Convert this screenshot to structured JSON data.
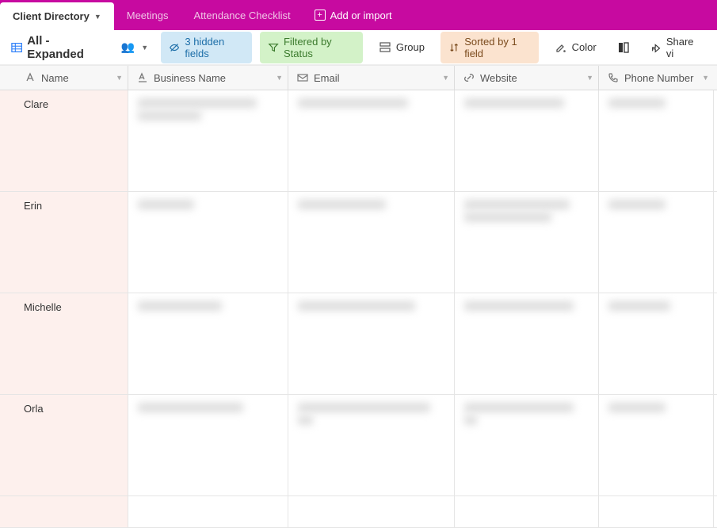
{
  "tabs": {
    "items": [
      {
        "label": "Client Directory",
        "active": true
      },
      {
        "label": "Meetings",
        "active": false
      },
      {
        "label": "Attendance Checklist",
        "active": false
      }
    ],
    "add_label": "Add or import"
  },
  "toolbar": {
    "view_name": "All - Expanded",
    "hidden_fields": "3 hidden fields",
    "filtered": "Filtered by Status",
    "group": "Group",
    "sorted": "Sorted by 1 field",
    "color": "Color",
    "share": "Share vi"
  },
  "columns": {
    "name": "Name",
    "business": "Business Name",
    "email": "Email",
    "website": "Website",
    "phone": "Phone Number"
  },
  "rows": [
    {
      "name": "Clare"
    },
    {
      "name": "Erin"
    },
    {
      "name": "Michelle"
    },
    {
      "name": "Orla"
    }
  ]
}
